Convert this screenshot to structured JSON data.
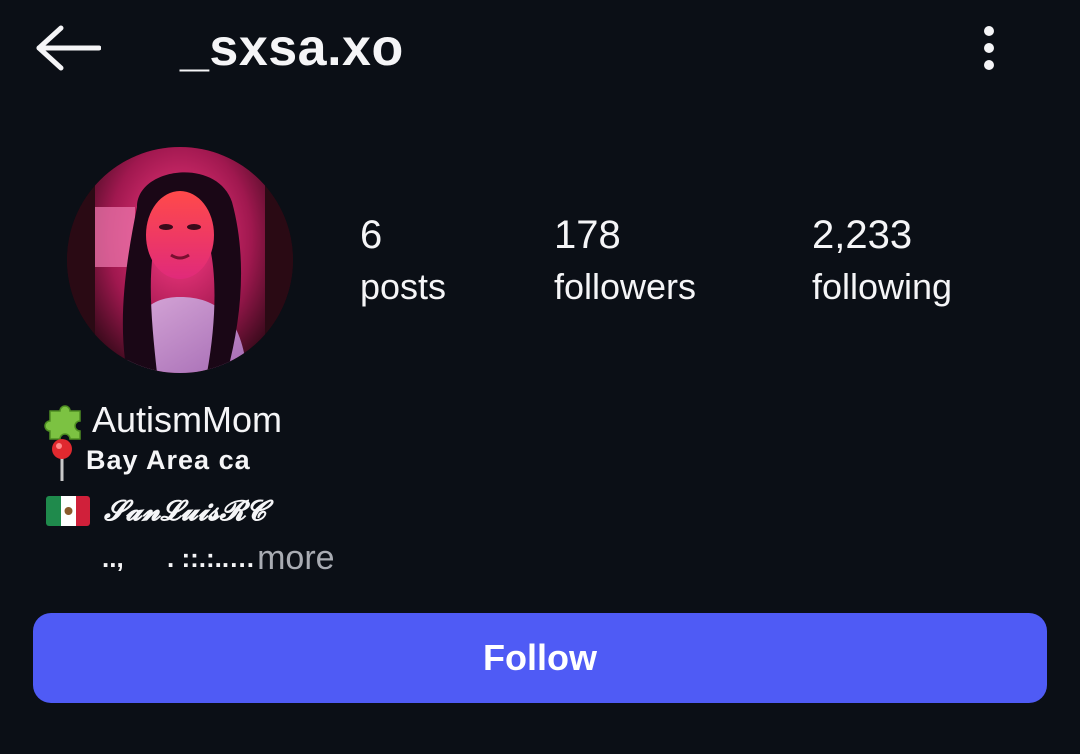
{
  "header": {
    "username": "_sxsa.xo",
    "back_icon": "arrow-left-icon",
    "menu_icon": "more-vertical-icon"
  },
  "profile": {
    "avatar_alt": "profile photo"
  },
  "stats": [
    {
      "value": "6",
      "label": "posts"
    },
    {
      "value": "178",
      "label": "followers"
    },
    {
      "value": "2,233",
      "label": "following"
    }
  ],
  "bio": {
    "line1_icon": "puzzle-piece-icon",
    "line1_text": "AutismMom",
    "line2_icon": "round-pushpin-icon",
    "line2_text": "Bay Area ca",
    "line3_icon": "mexico-flag-icon",
    "line3_text": "𝓢𝓪𝓷𝓛𝓾𝓲𝓼𝓡𝓒",
    "line4_text": "..,      . ::.:..…",
    "more_label": "more"
  },
  "actions": {
    "follow_label": "Follow"
  },
  "colors": {
    "background": "#0b0f16",
    "text": "#f5f5f7",
    "muted": "#a9acb3",
    "accent": "#4f5bf5"
  }
}
